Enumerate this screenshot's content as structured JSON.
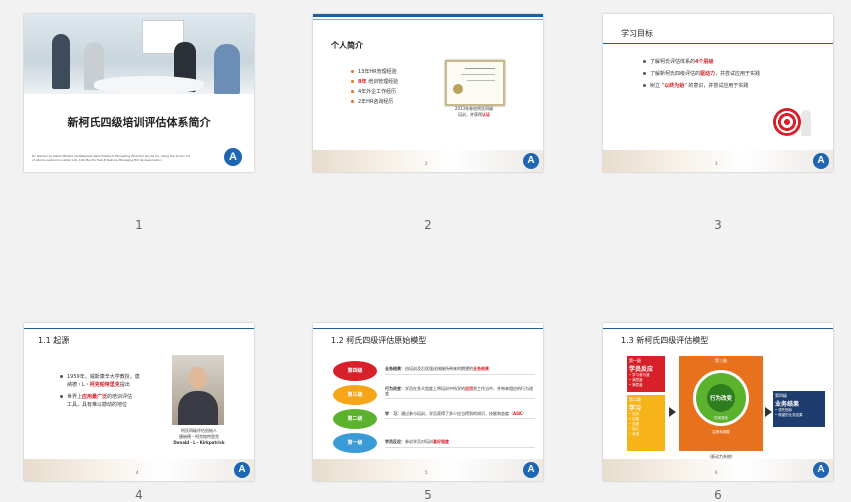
{
  "slides": [
    {
      "number": "1",
      "title": "新柯氏四级培训评估体系简介",
      "footnote": "Dr. Ranieri by Nakki Mirfeld conNeiphalo-lebis fldiaboh Fitneghing Zhentrm Ruchs Inc. Keng Xia fe ann lid of Atoma Leinz-Innovation Ltd. 100 Mei-Ho Hall-E-feature Managing Bill de Association",
      "logo": "A"
    },
    {
      "number": "2",
      "title": "个人简介",
      "bullets": [
        {
          "parts": [
            {
              "t": "13年HR管理经验",
              "h": false
            }
          ]
        },
        {
          "parts": [
            {
              "t": "8年",
              "h": true
            },
            {
              "t": " 培训管理经验",
              "h": false
            }
          ]
        },
        {
          "parts": [
            {
              "t": "4年外企工作经历",
              "h": false
            }
          ]
        },
        {
          "parts": [
            {
              "t": "2年HR咨询经历",
              "h": false
            }
          ]
        }
      ],
      "caption_line1": "2013年参加柯氏四级",
      "caption_line2a": "培训，并获得",
      "caption_line2b": "认证",
      "page": "2",
      "logo": "A"
    },
    {
      "number": "3",
      "title": "学习目标",
      "bullets": [
        {
          "parts": [
            {
              "t": "了解柯氏评估体系的",
              "h": false
            },
            {
              "t": "4个层级",
              "h": true
            }
          ]
        },
        {
          "parts": [
            {
              "t": "了解新柯氏四级评估的",
              "h": false
            },
            {
              "t": "驱动力",
              "h": true
            },
            {
              "t": "，并尝试应用于实践",
              "h": false
            }
          ]
        },
        {
          "parts": [
            {
              "t": "树立 “",
              "h": false
            },
            {
              "t": "以终为始",
              "h": true
            },
            {
              "t": "” 的意识，并尝试应用于实践",
              "h": false
            }
          ]
        }
      ],
      "page": "3",
      "logo": "A"
    },
    {
      "number": "4",
      "title": "1.1  起源",
      "bullets": [
        {
          "parts": [
            {
              "t": "1959年，威斯康辛大学教授，唐",
              "h": false
            }
          ]
        },
        {
          "parts": [
            {
              "t": "纳德・L・",
              "h": false
            },
            {
              "t": "柯克帕特里克",
              "h": true
            },
            {
              "t": "提出",
              "h": false
            }
          ]
        },
        {
          "parts": [
            {
              "t": "世界上",
              "h": false
            },
            {
              "t": "应用最广泛",
              "h": true
            },
            {
              "t": "的培训评估",
              "h": false
            }
          ]
        },
        {
          "parts": [
            {
              "t": "工具，具有难以撼动的地位",
              "h": false
            }
          ]
        }
      ],
      "caption_line1": "柯氏四级评估创始人",
      "caption_line2": "唐纳德・柯克帕特里克",
      "caption_line3": "Donald・L・Kirkpatrick",
      "page": "4",
      "logo": "A"
    },
    {
      "number": "5",
      "title": "1.2  柯氏四级评估原始模型",
      "levels": [
        "第四级",
        "第三级",
        "第二级",
        "第一级"
      ],
      "rows": [
        {
          "head": "业务结果：",
          "text": "由培训及后续强化措施所带来的期望的",
          "hl": "业务结果"
        },
        {
          "head": "行为改变：",
          "text": "学员在多大程度上将培训中所学的",
          "hl": "应用",
          "tail": "到工作当中，并带来相应的行为改变"
        },
        {
          "head": "学　习：",
          "text": "通过参与培训，学员获得了多少应当得到的知识、技能和态度（",
          "hl": "ASK",
          "tail": "）"
        },
        {
          "head": "学员反应：",
          "text": "参训学员对培训",
          "hl": "喜好程度"
        }
      ],
      "page": "5",
      "logo": "A"
    },
    {
      "number": "6",
      "title": "1.3  新柯氏四级评估模型",
      "level1": {
        "title": "第一级",
        "name": "学员反应",
        "items": [
          "• 学习参与度",
          "• 满意度",
          "• 满意度"
        ]
      },
      "level2": {
        "title": "第二级",
        "name": "学习",
        "items": [
          "• 知识",
          "• 技能",
          "• 态度",
          "• 信心",
          "• 承诺"
        ]
      },
      "level3": {
        "top": "第三级",
        "name": "行为改变",
        "ring_top": "监督和调整",
        "ring_bottom": "在岗强化"
      },
      "level4": {
        "title": "第四级",
        "name": "业务结果",
        "items": [
          "• 领先指标",
          "• 期望的业务结果"
        ]
      },
      "caption": "（驱动力系统）",
      "page": "6",
      "logo": "A"
    }
  ],
  "colors": {
    "accent": "#1f5f9f",
    "red": "#d8202a",
    "orange": "#e8711d",
    "yellow": "#f6b419",
    "green": "#5bb22d",
    "navy": "#1e3d6e"
  }
}
